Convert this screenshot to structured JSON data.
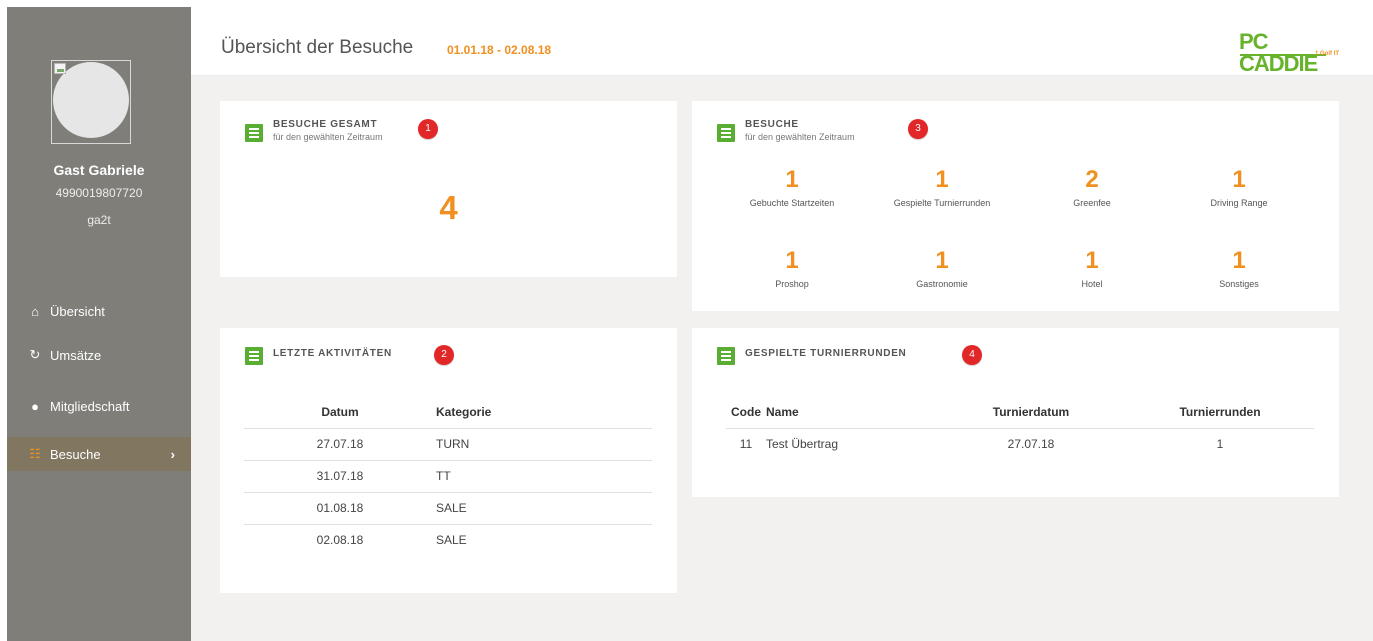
{
  "profile": {
    "name": "Gast Gabriele",
    "member_id": "4990019807720",
    "username": "ga2t"
  },
  "navigation": [
    {
      "label": "Übersicht",
      "icon": "home-icon"
    },
    {
      "label": "Umsätze",
      "icon": "refresh-icon"
    },
    {
      "label": "Mitgliedschaft",
      "icon": "user-icon"
    },
    {
      "label": "Besuche",
      "icon": "list-icon",
      "active": true
    }
  ],
  "header": {
    "title": "Übersicht der Besuche",
    "date_range": "01.01.18 - 02.08.18",
    "brand": "PC CADDIE",
    "brand_tagline": "1 Golf IT"
  },
  "colors": {
    "accent_orange": "#ef9020",
    "sidebar": "#7f7e79",
    "icon_green": "#58ad32",
    "badge_red": "#e12727"
  },
  "cards": {
    "total": {
      "title": "BESUCHE GESAMT",
      "subtitle": "für den gewählten Zeitraum",
      "badge": "1",
      "value": "4"
    },
    "visits": {
      "title": "BESUCHE",
      "subtitle": "für den gewählten Zeitraum",
      "badge": "3",
      "stats": [
        {
          "value": "1",
          "label": "Gebuchte Startzeiten"
        },
        {
          "value": "1",
          "label": "Gespielte Turnierrunden"
        },
        {
          "value": "2",
          "label": "Greenfee"
        },
        {
          "value": "1",
          "label": "Driving Range"
        },
        {
          "value": "1",
          "label": "Proshop"
        },
        {
          "value": "1",
          "label": "Gastronomie"
        },
        {
          "value": "1",
          "label": "Hotel"
        },
        {
          "value": "1",
          "label": "Sonstiges"
        }
      ]
    },
    "activities": {
      "title": "LETZTE AKTIVITÄTEN",
      "badge": "2",
      "columns": [
        "Datum",
        "Kategorie"
      ],
      "rows": [
        [
          "27.07.18",
          "TURN"
        ],
        [
          "31.07.18",
          "TT"
        ],
        [
          "01.08.18",
          "SALE"
        ],
        [
          "02.08.18",
          "SALE"
        ]
      ]
    },
    "tournaments": {
      "title": "GESPIELTE TURNIERRUNDEN",
      "badge": "4",
      "columns": [
        "Code",
        "Name",
        "Turnierdatum",
        "Turnierrunden"
      ],
      "rows": [
        [
          "11",
          "Test Übertrag",
          "27.07.18",
          "1"
        ]
      ]
    }
  }
}
